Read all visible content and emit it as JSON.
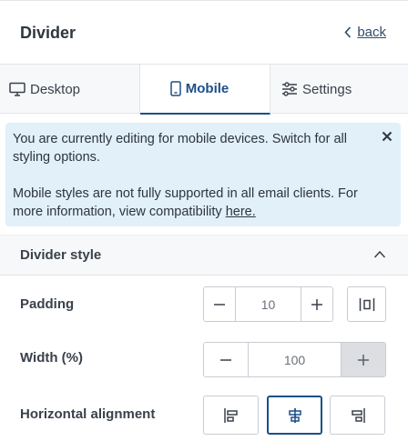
{
  "header": {
    "title": "Divider",
    "back_label": "back"
  },
  "tabs": [
    {
      "label": "Desktop",
      "icon": "desktop-icon"
    },
    {
      "label": "Mobile",
      "icon": "mobile-icon",
      "active": true
    },
    {
      "label": "Settings",
      "icon": "sliders-icon"
    }
  ],
  "info": {
    "line1": "You are currently editing for mobile devices. Switch for all styling options.",
    "line2_prefix": "Mobile styles are not fully supported in all email clients. For more information, view compatibility ",
    "line2_link": "here."
  },
  "section": {
    "title": "Divider style",
    "expanded": true
  },
  "padding": {
    "label": "Padding",
    "value": "10"
  },
  "width": {
    "label": "Width (%)",
    "value": "100"
  },
  "alignment": {
    "label": "Horizontal alignment",
    "options": [
      "left",
      "center",
      "right"
    ],
    "selected": "center"
  },
  "colors": {
    "accent": "#1c4f87",
    "info_bg": "#e1f0f9",
    "panel_bg": "#f7f8f9",
    "border": "#c8ccd2"
  }
}
